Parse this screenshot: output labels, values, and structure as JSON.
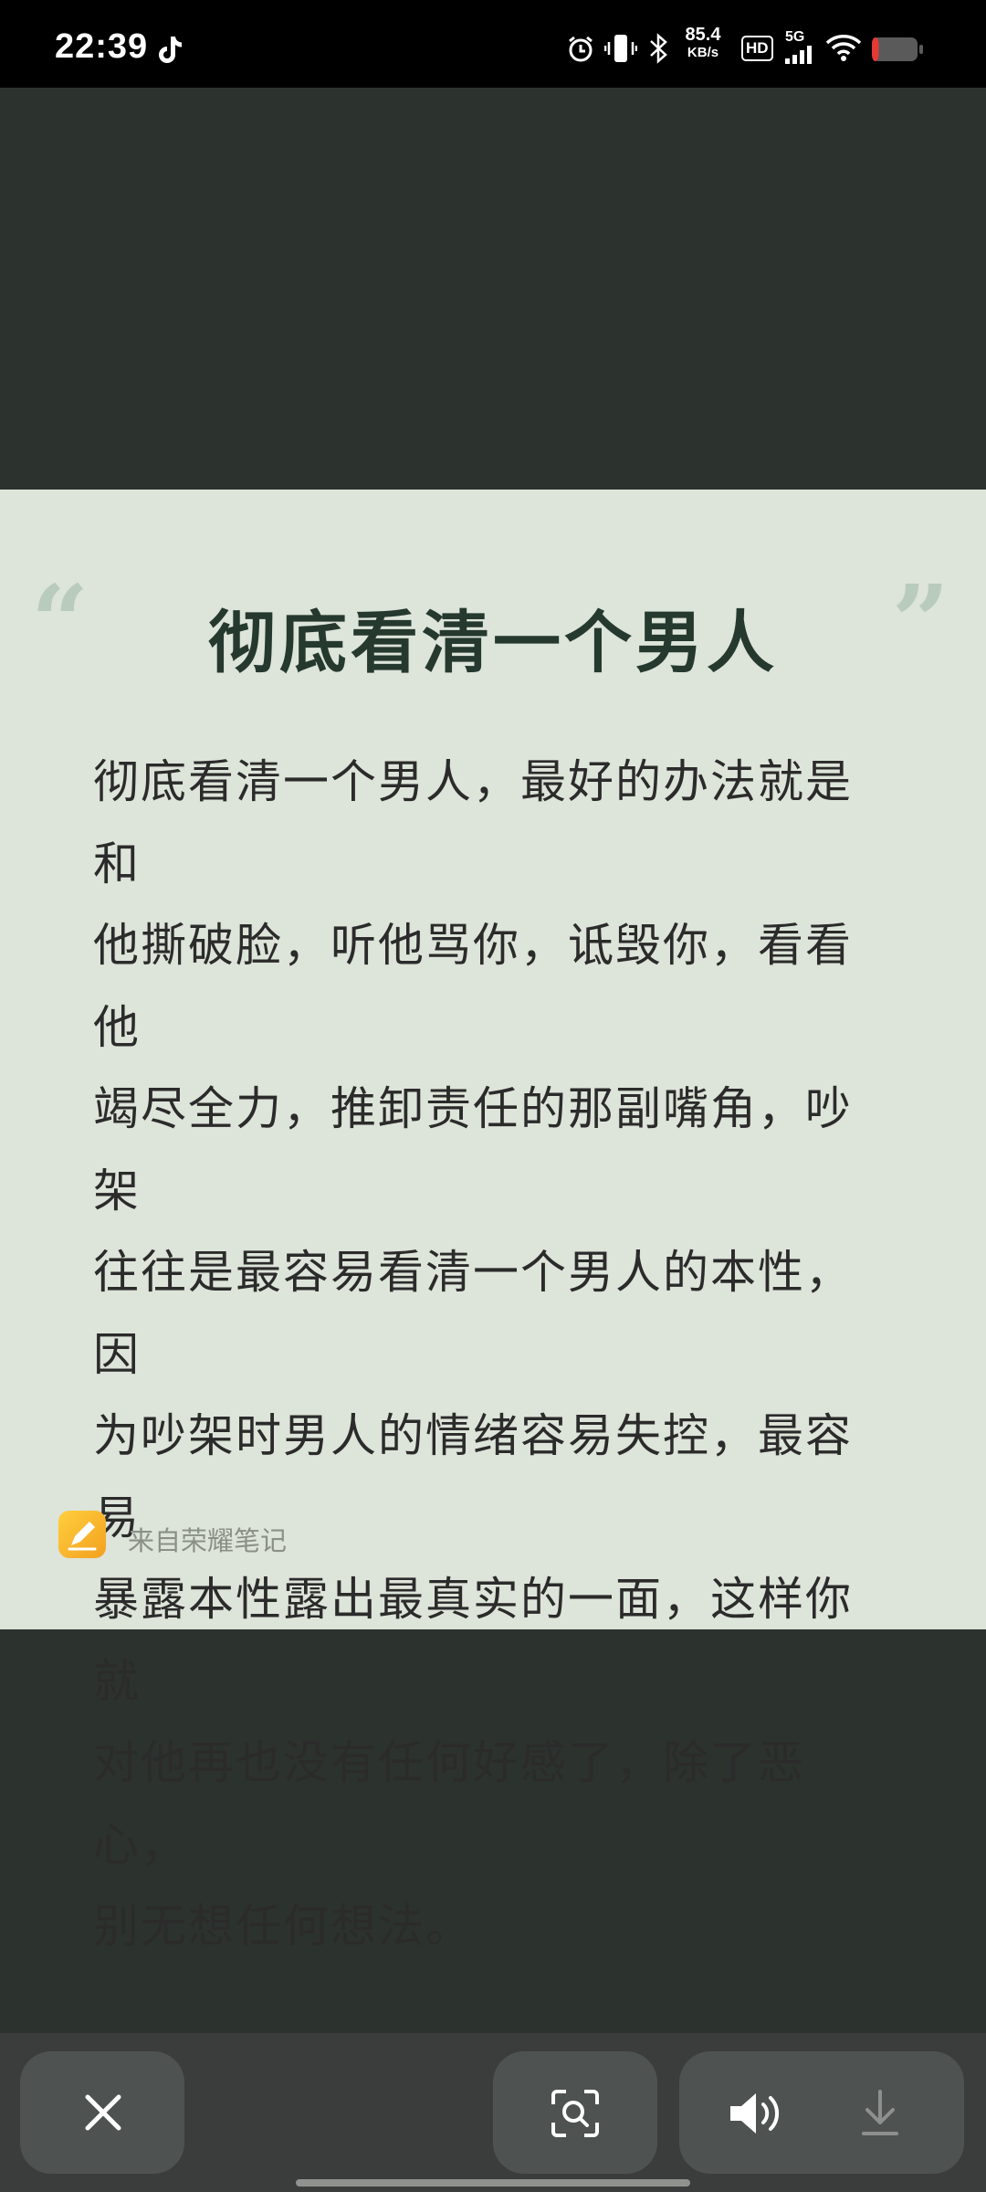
{
  "status_bar": {
    "time": "22:39",
    "network_speed_value": "85.4",
    "network_speed_unit": "KB/s",
    "hd_label": "HD",
    "network_type": "5G",
    "battery_level": 0.15,
    "battery_color": "#e53935",
    "icons": [
      "tiktok-icon",
      "alarm-icon",
      "vibrate-icon",
      "bluetooth-icon",
      "signal-icon",
      "wifi-icon",
      "battery-icon"
    ]
  },
  "note": {
    "title": "彻底看清一个男人",
    "body_lines": [
      "彻底看清一个男人，最好的办法就是和",
      "他撕破脸，听他骂你，诋毁你，看看他",
      "竭尽全力，推卸责任的那副嘴角，吵架",
      "往往是最容易看清一个男人的本性，因",
      "为吵架时男人的情绪容易失控，最容易",
      "暴露本性露出最真实的一面，这样你就",
      "对他再也没有任何好感了，除了恶心，",
      "别无想任何想法。"
    ],
    "quote_open": "“",
    "quote_close": "”",
    "source": "来自荣耀笔记"
  },
  "toolbar": {
    "icons": [
      "close-icon",
      "scan-icon",
      "volume-icon",
      "download-icon"
    ]
  },
  "colors": {
    "background": "#2c322e",
    "card": "#dde4d9",
    "title": "#26392f",
    "toolbar": "#3a3d3b",
    "button": "#4e5250"
  }
}
